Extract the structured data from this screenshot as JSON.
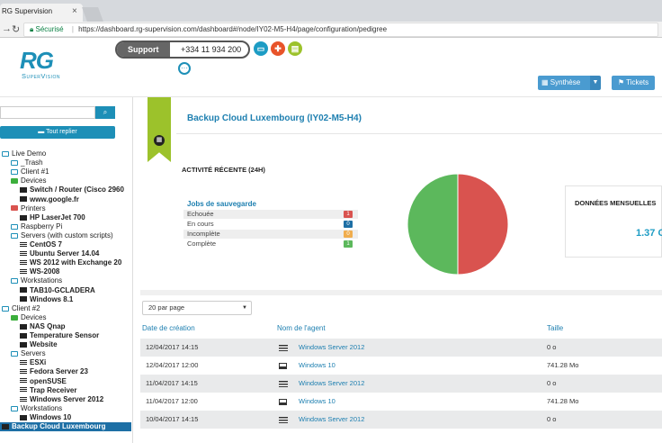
{
  "browser": {
    "tab_title": "RG Supervision",
    "tab_close": "×",
    "security_label": "Sécurisé",
    "url": "https://dashboard.rg-supervision.com/dashboard#/node/IY02-M5-H4/page/configuration/pedigree"
  },
  "header": {
    "logo_top": "RG",
    "logo_bottom": "SuperVision",
    "support_label": "Support",
    "support_phone": "+334 11 934 200",
    "synthese_label": "Synthèse",
    "tickets_label": "Tickets"
  },
  "sidebar": {
    "search_placeholder": "",
    "collapse_label": "Tout replier",
    "tree": [
      {
        "label": "Live Demo",
        "icon": "folder-blue-icon",
        "bold": false
      },
      {
        "label": "_Trash",
        "icon": "folder-blue-icon",
        "bold": false
      },
      {
        "label": "Client #1",
        "icon": "folder-blue-icon",
        "bold": false
      },
      {
        "label": "Devices",
        "icon": "folder-green-icon",
        "bold": false
      },
      {
        "label": "Switch / Router (Cisco 2960",
        "icon": "device-icon",
        "bold": true
      },
      {
        "label": "www.google.fr",
        "icon": "device-icon",
        "bold": true
      },
      {
        "label": "Printers",
        "icon": "folder-red-icon",
        "bold": false
      },
      {
        "label": "HP LaserJet 700",
        "icon": "device-icon",
        "bold": true
      },
      {
        "label": "Raspberry Pi",
        "icon": "folder-blue-icon",
        "bold": false
      },
      {
        "label": "Servers (with custom scripts)",
        "icon": "folder-blue-icon",
        "bold": false
      },
      {
        "label": "CentOS 7",
        "icon": "server-icon",
        "bold": true
      },
      {
        "label": "Ubuntu Server 14.04",
        "icon": "server-icon",
        "bold": true
      },
      {
        "label": "WS 2012 with Exchange 20",
        "icon": "server-icon",
        "bold": true
      },
      {
        "label": "WS-2008",
        "icon": "server-icon",
        "bold": true
      },
      {
        "label": "Workstations",
        "icon": "folder-blue-icon",
        "bold": false
      },
      {
        "label": "TAB10-GCLADERA",
        "icon": "pc-icon",
        "bold": true
      },
      {
        "label": "Windows 8.1",
        "icon": "pc-icon",
        "bold": true
      },
      {
        "label": "Client #2",
        "icon": "folder-blue-icon",
        "bold": false
      },
      {
        "label": "Devices",
        "icon": "folder-green-icon",
        "bold": false
      },
      {
        "label": "NAS Qnap",
        "icon": "device-icon",
        "bold": true
      },
      {
        "label": "Temperature Sensor",
        "icon": "device-icon",
        "bold": true
      },
      {
        "label": "Website",
        "icon": "device-icon",
        "bold": true
      },
      {
        "label": "Servers",
        "icon": "folder-blue-icon",
        "bold": false
      },
      {
        "label": "ESXi",
        "icon": "server-icon",
        "bold": true
      },
      {
        "label": "Fedora Server 23",
        "icon": "server-icon",
        "bold": true
      },
      {
        "label": "openSUSE",
        "icon": "server-icon",
        "bold": true
      },
      {
        "label": "Trap Receiver",
        "icon": "server-icon",
        "bold": true
      },
      {
        "label": "Windows Server 2012",
        "icon": "server-icon",
        "bold": true
      },
      {
        "label": "Workstations",
        "icon": "folder-blue-icon",
        "bold": false
      },
      {
        "label": "Windows 10",
        "icon": "pc-icon",
        "bold": true
      },
      {
        "label": "Backup Cloud Luxembourg",
        "icon": "grid-icon",
        "bold": true,
        "selected": true
      }
    ]
  },
  "main": {
    "page_title": "Backup Cloud Luxembourg (IY02-M5-H4)",
    "activity_title": "ACTIVITÉ RÉCENTE (24H)",
    "jobs_title": "Jobs de sauvegarde",
    "jobs": [
      {
        "label": "Echouée",
        "count": "1",
        "color": "#d9534f"
      },
      {
        "label": "En cours",
        "count": "0",
        "color": "#1d6fa5"
      },
      {
        "label": "Incomplète",
        "count": "0",
        "color": "#f0ad4e"
      },
      {
        "label": "Complète",
        "count": "1",
        "color": "#5cb85c"
      }
    ],
    "pie": {
      "slices": [
        {
          "name": "Echouée",
          "value": 1,
          "color": "#d9534f"
        },
        {
          "name": "Complète",
          "value": 1,
          "color": "#5cb85c"
        }
      ]
    },
    "monthly_title": "DONNÉES MENSUELLES",
    "monthly_value": "1.37 G",
    "perpage_label": "20 par page",
    "table": {
      "headers": [
        "Date de création",
        "Nom de l'agent",
        "Taille"
      ],
      "rows": [
        {
          "date": "12/04/2017 14:15",
          "icon": "server-icon",
          "agent": "Windows Server 2012",
          "size": "0 o"
        },
        {
          "date": "12/04/2017 12:00",
          "icon": "pc-icon",
          "agent": "Windows 10",
          "size": "741.28 Mo"
        },
        {
          "date": "11/04/2017 14:15",
          "icon": "server-icon",
          "agent": "Windows Server 2012",
          "size": "0 o"
        },
        {
          "date": "11/04/2017 12:00",
          "icon": "pc-icon",
          "agent": "Windows 10",
          "size": "741.28 Mo"
        },
        {
          "date": "10/04/2017 14:15",
          "icon": "server-icon",
          "agent": "Windows Server 2012",
          "size": "0 o"
        }
      ]
    }
  }
}
